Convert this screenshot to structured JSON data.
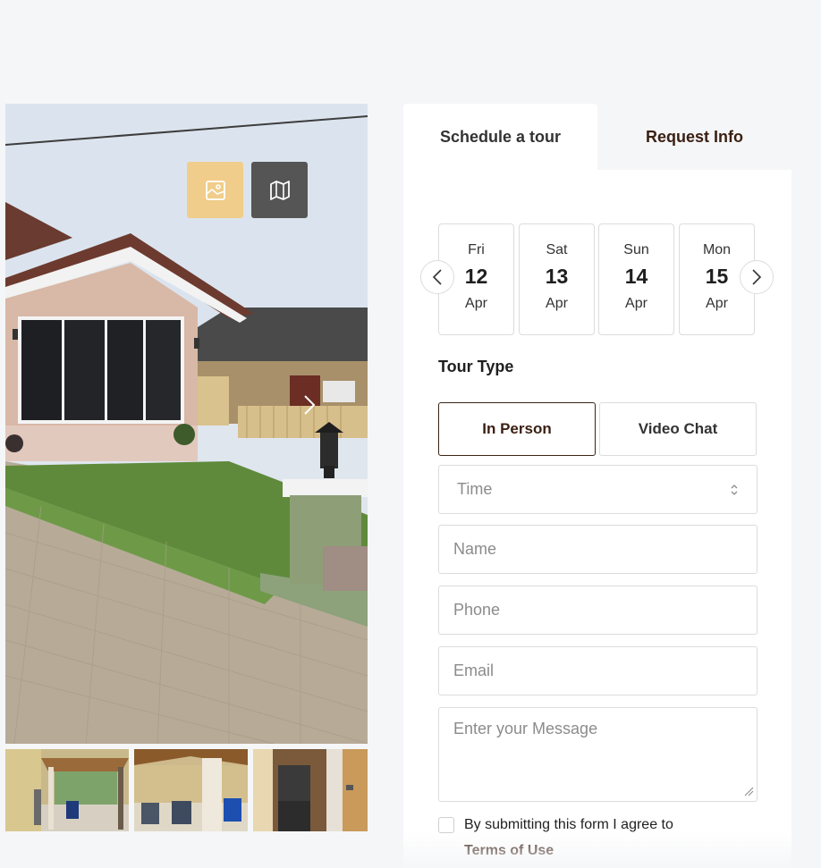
{
  "gallery": {
    "photo_view_icon": "photo-icon",
    "map_view_icon": "map-icon",
    "next_icon": "chevron-right-icon",
    "thumbnails": [
      {
        "name": "thumb-gazebo-yard"
      },
      {
        "name": "thumb-gazebo-chairs"
      },
      {
        "name": "thumb-laundry-room"
      }
    ]
  },
  "tabs": {
    "schedule_label": "Schedule a tour",
    "request_label": "Request Info"
  },
  "dates": [
    {
      "dow": "Fri",
      "day": "12",
      "month": "Apr"
    },
    {
      "dow": "Sat",
      "day": "13",
      "month": "Apr"
    },
    {
      "dow": "Sun",
      "day": "14",
      "month": "Apr"
    },
    {
      "dow": "Mon",
      "day": "15",
      "month": "Apr"
    }
  ],
  "tour_type": {
    "label": "Tour Type",
    "in_person": "In Person",
    "video_chat": "Video Chat",
    "selected": "In Person"
  },
  "form": {
    "time_placeholder": "Time",
    "name_placeholder": "Name",
    "phone_placeholder": "Phone",
    "email_placeholder": "Email",
    "message_placeholder": "Enter your Message",
    "consent_text": "By submitting this form I agree to",
    "terms_link": "Terms of Use"
  },
  "colors": {
    "accent_brown": "#3a1f12",
    "photo_button": "#f0cd8a",
    "map_button": "#555555"
  }
}
